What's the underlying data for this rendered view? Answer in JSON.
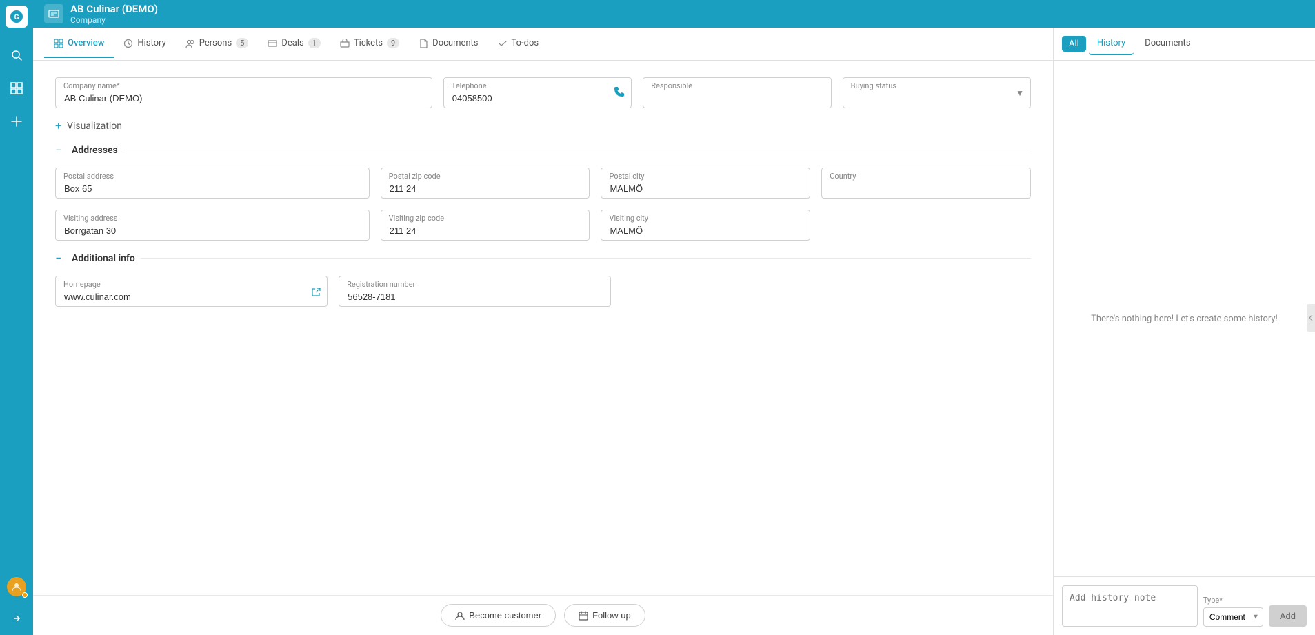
{
  "app": {
    "logo_text": "G",
    "topbar": {
      "icon_text": "≡",
      "company_name": "AB Culinar (DEMO)",
      "company_type": "Company"
    }
  },
  "sidebar": {
    "icons": [
      "🔍",
      "⊞",
      "＋"
    ]
  },
  "tabs": [
    {
      "id": "overview",
      "label": "Overview",
      "icon": "⊞",
      "badge": null,
      "active": true
    },
    {
      "id": "history",
      "label": "History",
      "icon": "🕐",
      "badge": null,
      "active": false
    },
    {
      "id": "persons",
      "label": "Persons",
      "icon": "👥",
      "badge": "5",
      "active": false
    },
    {
      "id": "deals",
      "label": "Deals",
      "icon": "📋",
      "badge": "1",
      "active": false
    },
    {
      "id": "tickets",
      "label": "Tickets",
      "icon": "🎫",
      "badge": "9",
      "active": false
    },
    {
      "id": "documents",
      "label": "Documents",
      "icon": "📄",
      "badge": null,
      "active": false
    },
    {
      "id": "todos",
      "label": "To-dos",
      "icon": "☑",
      "badge": null,
      "active": false
    }
  ],
  "form": {
    "company_name_label": "Company name*",
    "company_name_value": "AB Culinar (DEMO)",
    "telephone_label": "Telephone",
    "telephone_value": "04058500",
    "responsible_label": "Responsible",
    "responsible_value": "",
    "buying_status_label": "Buying status",
    "buying_status_value": "",
    "visualization_label": "Visualization",
    "addresses_label": "Addresses",
    "postal_address_label": "Postal address",
    "postal_address_value": "Box 65",
    "postal_zip_label": "Postal zip code",
    "postal_zip_value": "211 24",
    "postal_city_label": "Postal city",
    "postal_city_value": "MALMÖ",
    "country_label": "Country",
    "country_value": "",
    "visiting_address_label": "Visiting address",
    "visiting_address_value": "Borrgatan 30",
    "visiting_zip_label": "Visiting zip code",
    "visiting_zip_value": "211 24",
    "visiting_city_label": "Visiting city",
    "visiting_city_value": "MALMÖ",
    "additional_info_label": "Additional info",
    "homepage_label": "Homepage",
    "homepage_value": "www.culinar.com",
    "registration_label": "Registration number",
    "registration_value": "56528-7181"
  },
  "bottom_actions": {
    "become_customer_label": "Become customer",
    "follow_up_label": "Follow up"
  },
  "right_panel": {
    "tab_all": "All",
    "tab_history": "History",
    "tab_documents": "Documents",
    "empty_message": "There's nothing here! Let's create some history!",
    "history_placeholder": "Add history note",
    "type_label": "Type*",
    "type_value": "Comment",
    "add_button_label": "Add"
  }
}
